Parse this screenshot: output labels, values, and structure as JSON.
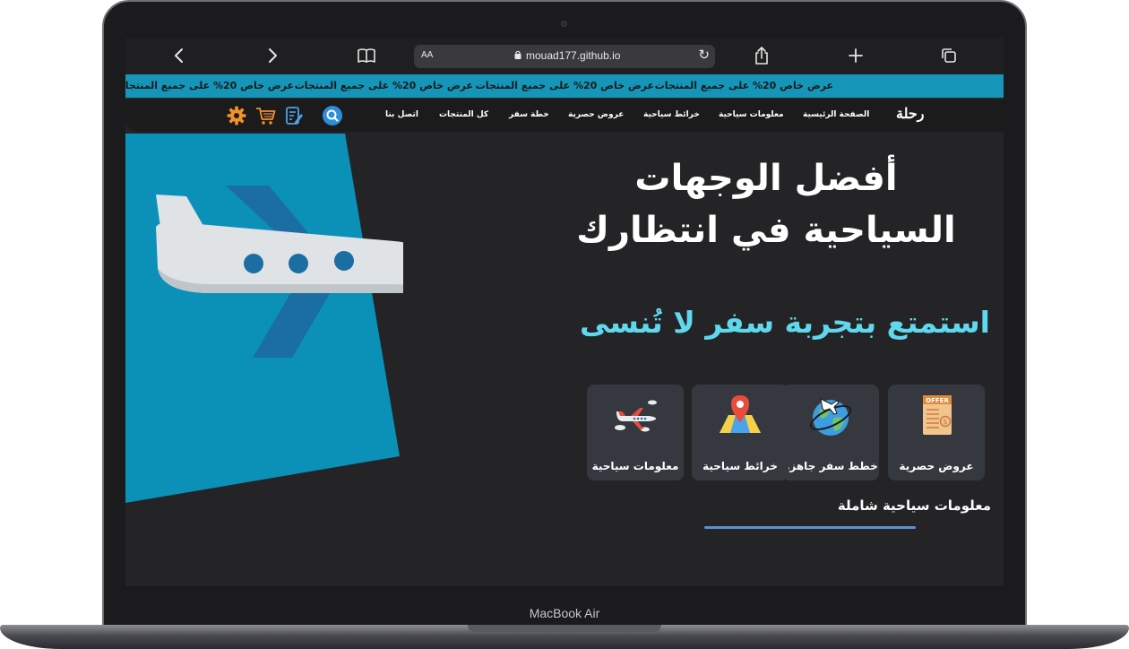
{
  "device": {
    "label": "MacBook Air"
  },
  "browser": {
    "reader_label": "AA",
    "url": "mouad177.github.io",
    "back_glyph": "‹",
    "forward_glyph": "›",
    "new_tab_glyph": "+",
    "reload_glyph": "↻"
  },
  "promo": {
    "items": [
      "عرض خاص 20% على جميع المنتجات",
      "عرض خاص 20% على جميع المنتجات",
      "عرض خاص 20% على جميع المنتجات",
      "عرض خاص 20% على جميع المنتجات"
    ]
  },
  "nav": {
    "logo": "رحلة",
    "links": [
      "الصفحة الرئيسية",
      "معلومات سياحية",
      "خرائط سياحية",
      "عروض حصرية",
      "خطة سفر",
      "كل المنتجات",
      "اتصل بنا"
    ],
    "icons": [
      "search-icon",
      "notes-icon",
      "cart-icon",
      "settings-icon"
    ]
  },
  "hero": {
    "title_line1": "أفضل الوجهات",
    "title_line2": "السياحية في انتظارك",
    "subtitle": "استمتع بتجربة سفر لا تُنسى"
  },
  "cards": [
    {
      "label": "عروض حصرية",
      "icon": "offer-document-icon"
    },
    {
      "label": "خطط سفر جاهزة",
      "icon": "globe-plane-icon"
    },
    {
      "label": "خرائط سياحية",
      "icon": "map-pin-icon"
    },
    {
      "label": "معلومات سياحية",
      "icon": "airplane-icon"
    }
  ],
  "section": {
    "heading": "معلومات سياحية شاملة"
  },
  "colors": {
    "promo_bg": "#1595b8",
    "accent_cyan": "#5fd8ee",
    "underline": "#5b8fd6",
    "page_bg": "#242426",
    "card_bg": "#35393f"
  }
}
